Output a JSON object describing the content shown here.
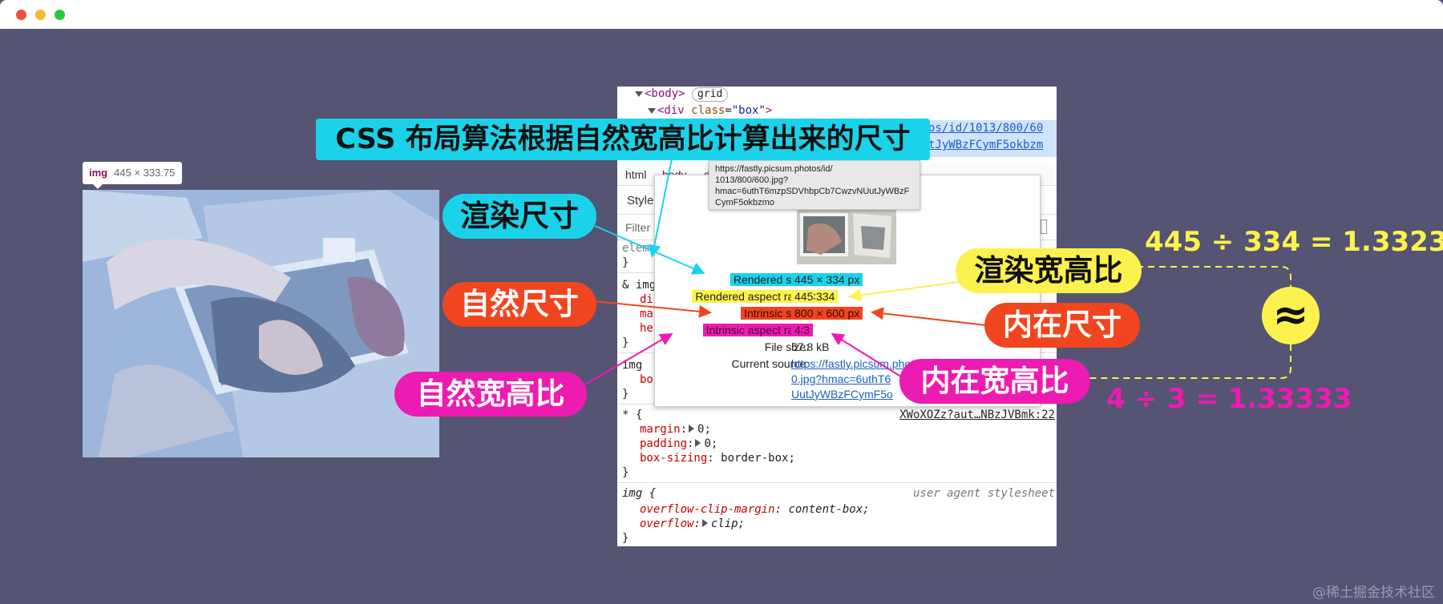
{
  "window": {
    "colors": {
      "background": "#555473",
      "titlebar": "#ffffff"
    }
  },
  "inspected_image": {
    "tag_name": "img",
    "tag_size": "445 × 333.75"
  },
  "devtools": {
    "dom": {
      "body_tag": "<body>",
      "body_badge": "grid",
      "div_open": "<div ",
      "div_attr": "class",
      "div_eq": "=",
      "div_value": "\"box\"",
      "div_close": ">",
      "src_line1_frag": "os/id/1013/800/60",
      "src_line2_frag": "tJyWBzFCymF5okbzm"
    },
    "breadcrumb": [
      "html",
      "body",
      "d"
    ],
    "styles_tab": "Style",
    "filter_placeholder": "Filter",
    "rules": {
      "elem_frag": "elem",
      "brace_close": "}",
      "img_rule_frag": "& img",
      "decl_frags": [
        "di",
        "ma",
        "he"
      ],
      "img_rule2_frag": "img",
      "img_rule2_decl": "bo",
      "universal_selector": "* {",
      "universal_source": "XWoXOZz?aut…NBzJVBmk:22",
      "universal_decls": [
        {
          "prop": "margin",
          "value": "0;"
        },
        {
          "prop": "padding",
          "value": "0;"
        },
        {
          "prop": "box-sizing",
          "value": "border-box;"
        }
      ],
      "ua_selector": "img {",
      "ua_source": "user agent stylesheet",
      "ua_decls": [
        {
          "prop": "overflow-clip-margin",
          "value": "content-box;",
          "arrow": false
        },
        {
          "prop": "overflow",
          "value": "clip;",
          "arrow": true
        }
      ]
    }
  },
  "url_tooltip": {
    "lines": [
      "https://fastly.picsum.photos/id/",
      "1013/800/600.jpg?",
      "hmac=6uthT6mzpSDVhbpCb7CwzvNUutJyWBzF",
      "CymF5okbzmo"
    ]
  },
  "image_popup": {
    "rows": [
      {
        "label": "Rendered size:",
        "value": "445 × 334 px"
      },
      {
        "label": "Rendered aspect ratio:",
        "value": "445∶334"
      },
      {
        "label": "Intrinsic size:",
        "value": "800 × 600 px"
      },
      {
        "label": "Intrinsic aspect ratio:",
        "value": "4∶3"
      },
      {
        "label": "File size:",
        "value": "57.8 kB"
      },
      {
        "label": "Current source:",
        "value_lines": [
          "https://fastly.picsum.photos/id/1013/800/60",
          "0.jpg?hmac=6uthT6",
          "UutJyWBzFCymF5o"
        ]
      }
    ]
  },
  "callouts": {
    "banner": "CSS 布局算法根据自然宽高比计算出来的尺寸",
    "rendered_size": "渲染尺寸",
    "natural_size": "自然尺寸",
    "natural_ratio": "自然宽高比",
    "rendered_ratio": "渲染宽高比",
    "intrinsic_size": "内在尺寸",
    "intrinsic_ratio": "内在宽高比"
  },
  "math": {
    "top": "445 ÷ 334 = 1.33233",
    "bottom": "4 ÷ 3 = 1.33333",
    "approx_symbol": "≈"
  },
  "accent_colors": {
    "cyan": "#1ad3ea",
    "yellow": "#fdf24d",
    "orange": "#f0451f",
    "magenta": "#ec1bb2"
  },
  "watermark": "@稀土掘金技术社区"
}
